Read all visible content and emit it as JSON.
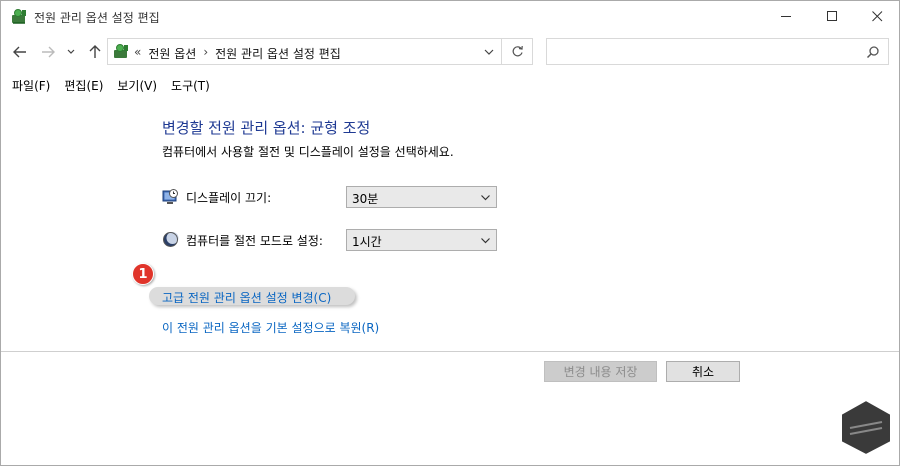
{
  "window": {
    "title": "전원 관리 옵션 설정 편집",
    "controls": {
      "minimize": "minimize-icon",
      "maximize": "maximize-icon",
      "close": "close-icon"
    }
  },
  "navigation": {
    "breadcrumb": [
      {
        "label": "«"
      },
      {
        "label": "전원 옵션"
      },
      {
        "label": "›"
      },
      {
        "label": "전원 관리 옵션 설정 편집"
      }
    ],
    "search": {
      "value": "",
      "placeholder": ""
    }
  },
  "menu": {
    "items": [
      {
        "label": "파일(F)"
      },
      {
        "label": "편집(E)"
      },
      {
        "label": "보기(V)"
      },
      {
        "label": "도구(T)"
      }
    ]
  },
  "content": {
    "heading": "변경할 전원 관리 옵션: 균형 조정",
    "subtitle": "컴퓨터에서 사용할 절전 및 디스플레이 설정을 선택하세요.",
    "settings": [
      {
        "label": "디스플레이 끄기:",
        "value": "30분",
        "icon": "monitor-clock-icon"
      },
      {
        "label": "컴퓨터를 절전 모드로 설정:",
        "value": "1시간",
        "icon": "moon-icon"
      }
    ],
    "links": {
      "advanced": "고급 전원 관리 옵션 설정 변경(C)",
      "restore": "이 전원 관리 옵션을 기본 설정으로 복원(R)"
    },
    "step_badge": "1"
  },
  "footer": {
    "save_label": "변경 내용 저장",
    "cancel_label": "취소"
  },
  "colors": {
    "heading": "#1f3a93",
    "link": "#0a66c2",
    "badge": "#e0342a"
  }
}
